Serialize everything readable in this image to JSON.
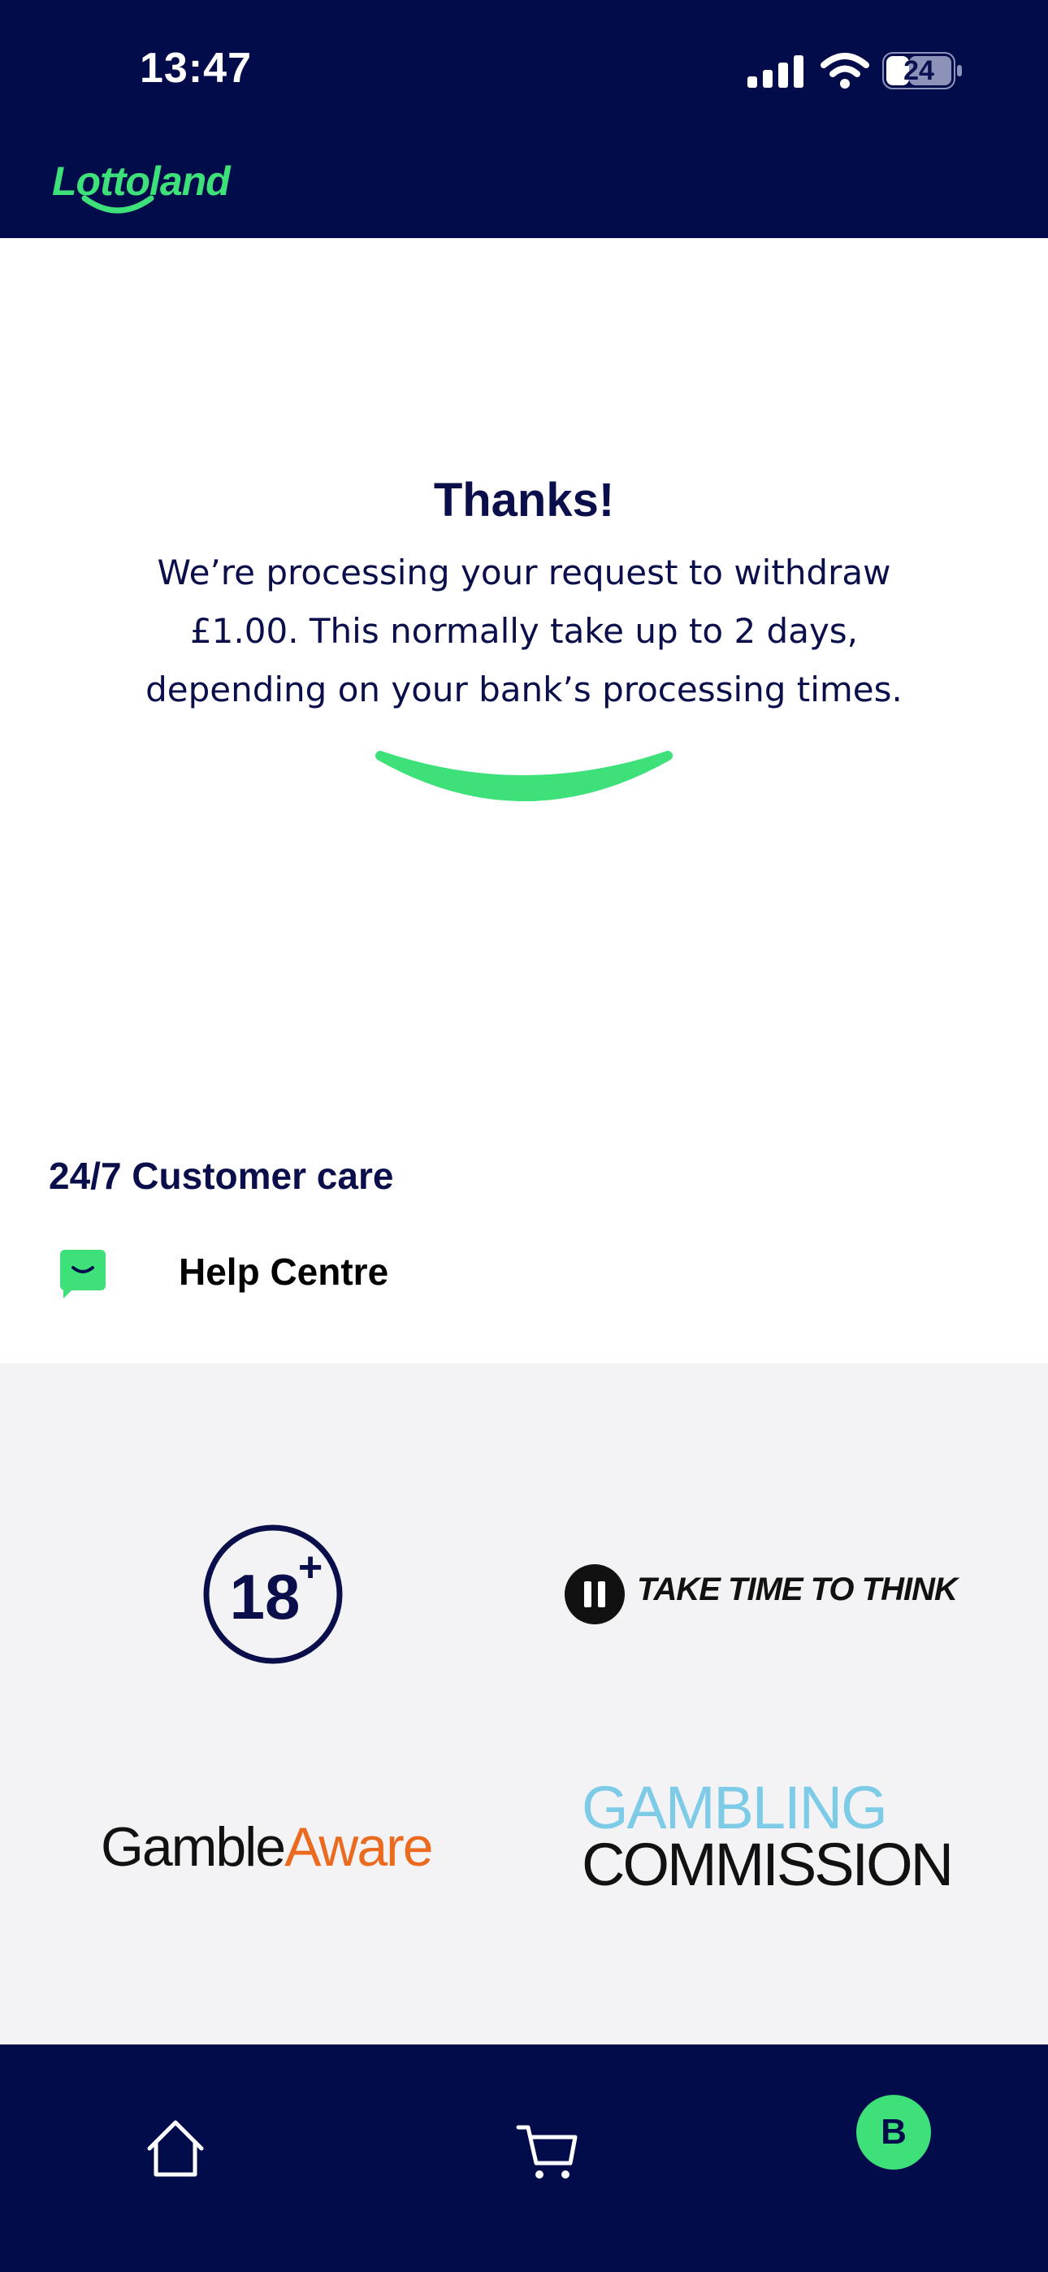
{
  "status_bar": {
    "time": "13:47",
    "battery_level": "24",
    "icons": [
      "signal-icon",
      "wifi-icon",
      "battery-icon"
    ]
  },
  "header": {
    "logo_text": "Lottoland",
    "brand_color": "#3ee07a",
    "background_color": "#030c4a"
  },
  "confirmation": {
    "title": "Thanks!",
    "message": "We’re processing your request to withdraw £1.00. This normally take up to 2 days, depending on your bank’s processing times."
  },
  "customer_care": {
    "title": "24/7 Customer care",
    "help_label": "Help Centre",
    "icon": "chat-icon"
  },
  "responsible_gambling": {
    "age_badge": "18",
    "age_plus": "+",
    "take_time_text": "TAKE TIME TO THINK",
    "gamble_aware_part1": "Gamble",
    "gamble_aware_part2": "Aware",
    "gambling_commission_line1": "GAMBLING",
    "gambling_commission_line2": "COMMISSION"
  },
  "tab_bar": {
    "tabs": [
      "home-icon",
      "cart-icon",
      "account-avatar"
    ],
    "avatar_initial": "B"
  }
}
